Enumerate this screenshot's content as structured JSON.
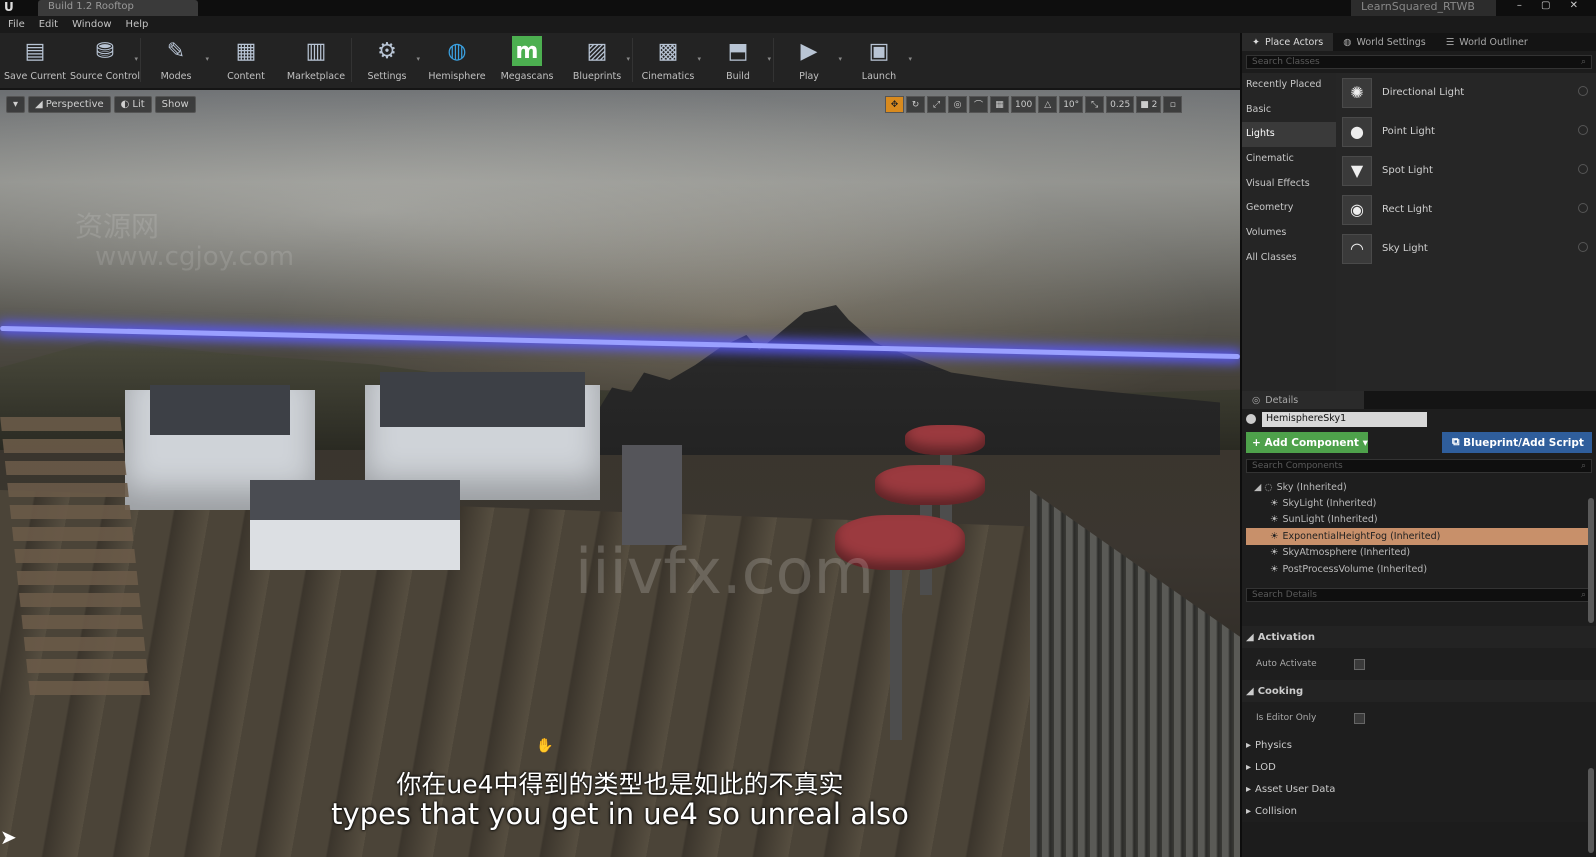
{
  "titlebar": {
    "tab": "Build 1.2 Rooftop",
    "project": "LearnSquared_RTWB",
    "controls": "– ▢ ✕"
  },
  "menu": [
    "File",
    "Edit",
    "Window",
    "Help"
  ],
  "toolbar": [
    {
      "label": "Save Current",
      "icon": "save-icon",
      "glyph": "▤"
    },
    {
      "label": "Source Control",
      "icon": "source-control-icon",
      "glyph": "⛃"
    },
    {
      "label": "Modes",
      "icon": "modes-icon",
      "glyph": "✎"
    },
    {
      "label": "Content",
      "icon": "content-icon",
      "glyph": "▦"
    },
    {
      "label": "Marketplace",
      "icon": "marketplace-icon",
      "glyph": "▥"
    },
    {
      "label": "Settings",
      "icon": "settings-icon",
      "glyph": "⚙"
    },
    {
      "label": "Hemisphere",
      "icon": "hemisphere-icon",
      "glyph": "◍"
    },
    {
      "label": "Megascans",
      "icon": "megascans-icon",
      "glyph": "m"
    },
    {
      "label": "Blueprints",
      "icon": "blueprints-icon",
      "glyph": "▨"
    },
    {
      "label": "Cinematics",
      "icon": "cinematics-icon",
      "glyph": "▩"
    },
    {
      "label": "Build",
      "icon": "build-icon",
      "glyph": "⬒"
    },
    {
      "label": "Play",
      "icon": "play-icon",
      "glyph": "▶"
    },
    {
      "label": "Launch",
      "icon": "launch-icon",
      "glyph": "▣"
    }
  ],
  "viewport": {
    "perspective": "Perspective",
    "lit": "Lit",
    "show": "Show",
    "grid_snap": "100",
    "rot_snap": "10°",
    "scale_snap": "0.25",
    "camera_speed": "2",
    "watermark": "iiivfx.com",
    "watermark_cn": "资源网",
    "watermark_url": "www.cgjoy.com"
  },
  "subtitles": {
    "cn": "你在ue4中得到的类型也是如此的不真实",
    "en": "types that you get in ue4 so unreal also"
  },
  "right_tabs": [
    "Place Actors",
    "World Settings",
    "World Outliner"
  ],
  "place_actors": {
    "search_placeholder": "Search Classes",
    "categories": [
      "Recently Placed",
      "Basic",
      "Lights",
      "Cinematic",
      "Visual Effects",
      "Geometry",
      "Volumes",
      "All Classes"
    ],
    "active_category": "Lights",
    "items": [
      {
        "name": "Directional Light",
        "glyph": "✺"
      },
      {
        "name": "Point Light",
        "glyph": "●"
      },
      {
        "name": "Spot Light",
        "glyph": "▼"
      },
      {
        "name": "Rect Light",
        "glyph": "◉"
      },
      {
        "name": "Sky Light",
        "glyph": "◠"
      }
    ]
  },
  "details": {
    "tab": "Details",
    "name": "HemisphereSky1",
    "add_component": "+ Add Component ▾",
    "blueprint_button": "Blueprint/Add Script",
    "search_components": "Search Components",
    "search_details": "Search Details",
    "components": [
      {
        "name": "Sky (Inherited)",
        "level": "root",
        "selected": false
      },
      {
        "name": "SkyLight (Inherited)",
        "level": "child",
        "selected": false
      },
      {
        "name": "SunLight (Inherited)",
        "level": "child",
        "selected": false
      },
      {
        "name": "ExponentialHeightFog (Inherited)",
        "level": "child",
        "selected": true
      },
      {
        "name": "SkyAtmosphere (Inherited)",
        "level": "child",
        "selected": false
      },
      {
        "name": "PostProcessVolume (Inherited)",
        "level": "child",
        "selected": false
      }
    ],
    "sections": {
      "activation": "Activation",
      "auto_activate": "Auto Activate",
      "cooking": "Cooking",
      "editor_only": "Is Editor Only",
      "physics": "Physics",
      "lod": "LOD",
      "asset_user_data": "Asset User Data",
      "collision": "Collision"
    }
  },
  "colors": {
    "add_component": "#4ea14b",
    "blueprint": "#2f5e9c",
    "selected_component": "#c8906a",
    "active_snap": "#d88a1e"
  }
}
